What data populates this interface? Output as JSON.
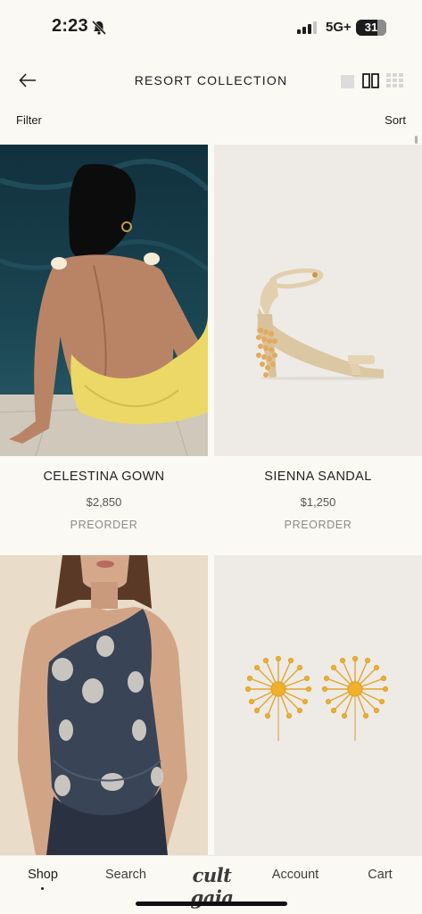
{
  "status_bar": {
    "time": "2:23",
    "network": "5G+",
    "battery": "31",
    "icons": [
      "bell-slash-icon",
      "signal-icon",
      "battery-icon"
    ]
  },
  "header": {
    "title": "RESORT COLLECTION",
    "back_icon": "arrow-left-icon",
    "view_icons": [
      "view-single-icon",
      "view-double-icon",
      "view-grid-icon"
    ]
  },
  "toolbar": {
    "filter_label": "Filter",
    "sort_label": "Sort"
  },
  "products": [
    {
      "name": "CELESTINA GOWN",
      "price": "$2,850",
      "status": "PREORDER",
      "image": "woman in yellow backless gown"
    },
    {
      "name": "SIENNA SANDAL",
      "price": "$1,250",
      "status": "PREORDER",
      "image": "beaded heel sandal"
    },
    {
      "name": "",
      "price": "",
      "status": "",
      "image": "one-shoulder navy sequin dress"
    },
    {
      "name": "",
      "price": "",
      "status": "",
      "image": "gold starburst earrings"
    }
  ],
  "tab_bar": {
    "shop": "Shop",
    "search": "Search",
    "brand": "cult gaia",
    "account": "Account",
    "cart": "Cart",
    "active_tab": "Shop"
  },
  "colors": {
    "background": "#fbf9f4",
    "text": "#1c1c1c",
    "muted": "#8a8a8a"
  }
}
